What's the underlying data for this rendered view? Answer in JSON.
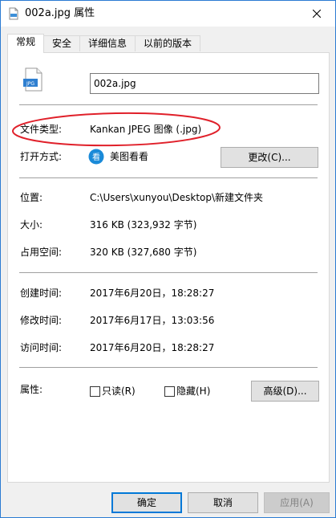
{
  "window": {
    "title": "002a.jpg 属性"
  },
  "tabs": [
    {
      "label": "常规"
    },
    {
      "label": "安全"
    },
    {
      "label": "详细信息"
    },
    {
      "label": "以前的版本"
    }
  ],
  "general": {
    "file_icon_text": "JPG",
    "filename": "002a.jpg",
    "file_type_label": "文件类型:",
    "file_type_value": "Kankan JPEG 图像 (.jpg)",
    "open_with_label": "打开方式:",
    "open_with_app_icon_text": "看",
    "open_with_app": "美图看看",
    "change_button": "更改(C)...",
    "location_label": "位置:",
    "location_value": "C:\\Users\\xunyou\\Desktop\\新建文件夹",
    "size_label": "大小:",
    "size_value": "316 KB (323,932 字节)",
    "size_on_disk_label": "占用空间:",
    "size_on_disk_value": "320 KB (327,680 字节)",
    "created_label": "创建时间:",
    "created_value": "2017年6月20日，18:28:27",
    "modified_label": "修改时间:",
    "modified_value": "2017年6月17日，13:03:56",
    "accessed_label": "访问时间:",
    "accessed_value": "2017年6月20日，18:28:27",
    "attributes_label": "属性:",
    "readonly_label": "只读(R)",
    "hidden_label": "隐藏(H)",
    "advanced_button": "高级(D)..."
  },
  "footer": {
    "ok": "确定",
    "cancel": "取消",
    "apply": "应用(A)"
  },
  "colors": {
    "accent": "#0078d7",
    "annotation_red": "#e0202a",
    "window_border": "#2b7bd3"
  },
  "icons": {
    "title_icon": "jpg-file-icon",
    "close": "close-icon",
    "app": "meitu-kankan-app-icon"
  }
}
